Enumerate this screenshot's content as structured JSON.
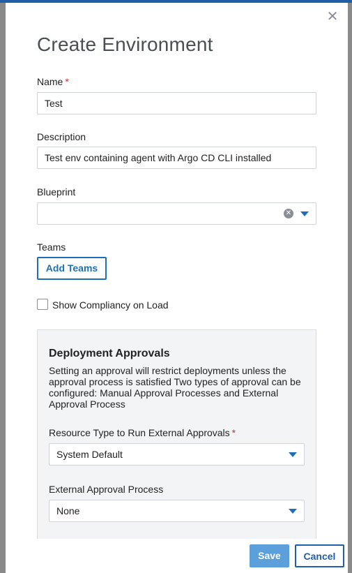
{
  "modal": {
    "title": "Create Environment",
    "close_icon": "close-icon"
  },
  "form": {
    "name": {
      "label": "Name",
      "required_mark": "*",
      "value": "Test"
    },
    "description": {
      "label": "Description",
      "value": "Test env containing agent with Argo CD CLI installed"
    },
    "blueprint": {
      "label": "Blueprint",
      "value": ""
    },
    "teams": {
      "label": "Teams",
      "button_label": "Add Teams"
    },
    "compliancy": {
      "label": "Show Compliancy on Load",
      "checked": false
    }
  },
  "approvals": {
    "title": "Deployment Approvals",
    "description": "Setting an approval will restrict deployments unless the approval process is satisfied Two types of approval can be configured: Manual Approval Processes and External Approval Process",
    "resource_type": {
      "label": "Resource Type to Run External Approvals",
      "required_mark": "*",
      "value": "System Default"
    },
    "external_process": {
      "label": "External Approval Process",
      "value": "None"
    }
  },
  "footer": {
    "save_label": "Save",
    "cancel_label": "Cancel"
  },
  "colors": {
    "accent": "#1f6fb8",
    "save_bg": "#5b9fdb",
    "required": "#d0302b"
  }
}
